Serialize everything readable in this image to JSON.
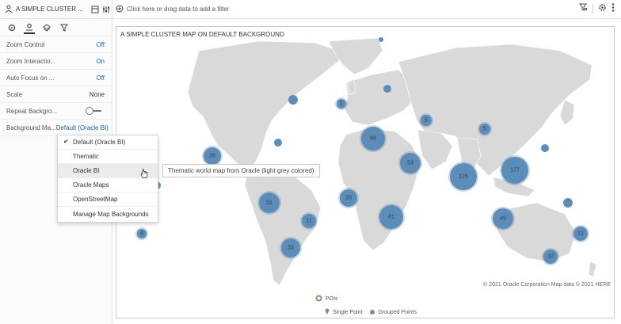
{
  "panel": {
    "title": "A SIMPLE CLUSTER ...",
    "properties": [
      {
        "label": "Zoom Control",
        "value": "Off"
      },
      {
        "label": "Zoom Interactio...",
        "value": "On"
      },
      {
        "label": "Auto Focus on ...",
        "value": "Off"
      },
      {
        "label": "Scale",
        "value": "None"
      },
      {
        "label": "Repeat Backgro...",
        "value": ""
      },
      {
        "label": "Background Ma...",
        "value": "Default (Oracle BI)"
      }
    ]
  },
  "dropdown": {
    "options": [
      "Default (Oracle BI)",
      "Thematic",
      "Oracle BI",
      "Oracle Maps",
      "OpenStreetMap",
      "Manage Map Backgrounds"
    ],
    "selected": "Default (Oracle BI)",
    "hovered": "Oracle BI"
  },
  "tooltip": {
    "text": "Thematic world map from Oracle (light grey colored)"
  },
  "filterbar": {
    "hint": "Click here or drag data to add a filter"
  },
  "map": {
    "title": "A SIMPLE CLUSTER MAP ON DEFAULT BACKGROUND",
    "attribution": "© 2021 Oracle Corporation   Map data © 2021 HERE",
    "legend": {
      "layer": "POIs",
      "single": "Single Point",
      "grouped": "Grouped Points"
    },
    "clusters": [
      {
        "label": "88"
      },
      {
        "label": "126"
      },
      {
        "label": "177"
      },
      {
        "label": "53"
      },
      {
        "label": "81"
      },
      {
        "label": "51"
      },
      {
        "label": "49"
      },
      {
        "label": "26"
      },
      {
        "label": "33"
      },
      {
        "label": "20"
      },
      {
        "label": "11"
      },
      {
        "label": "12"
      },
      {
        "label": "10"
      },
      {
        "label": "5"
      },
      {
        "label": "5"
      },
      {
        "label": "4"
      },
      {
        "label": "2"
      }
    ]
  },
  "colors": {
    "cluster": "#5b8db8",
    "land": "#d9d9d9",
    "link": "#1f64a8"
  }
}
